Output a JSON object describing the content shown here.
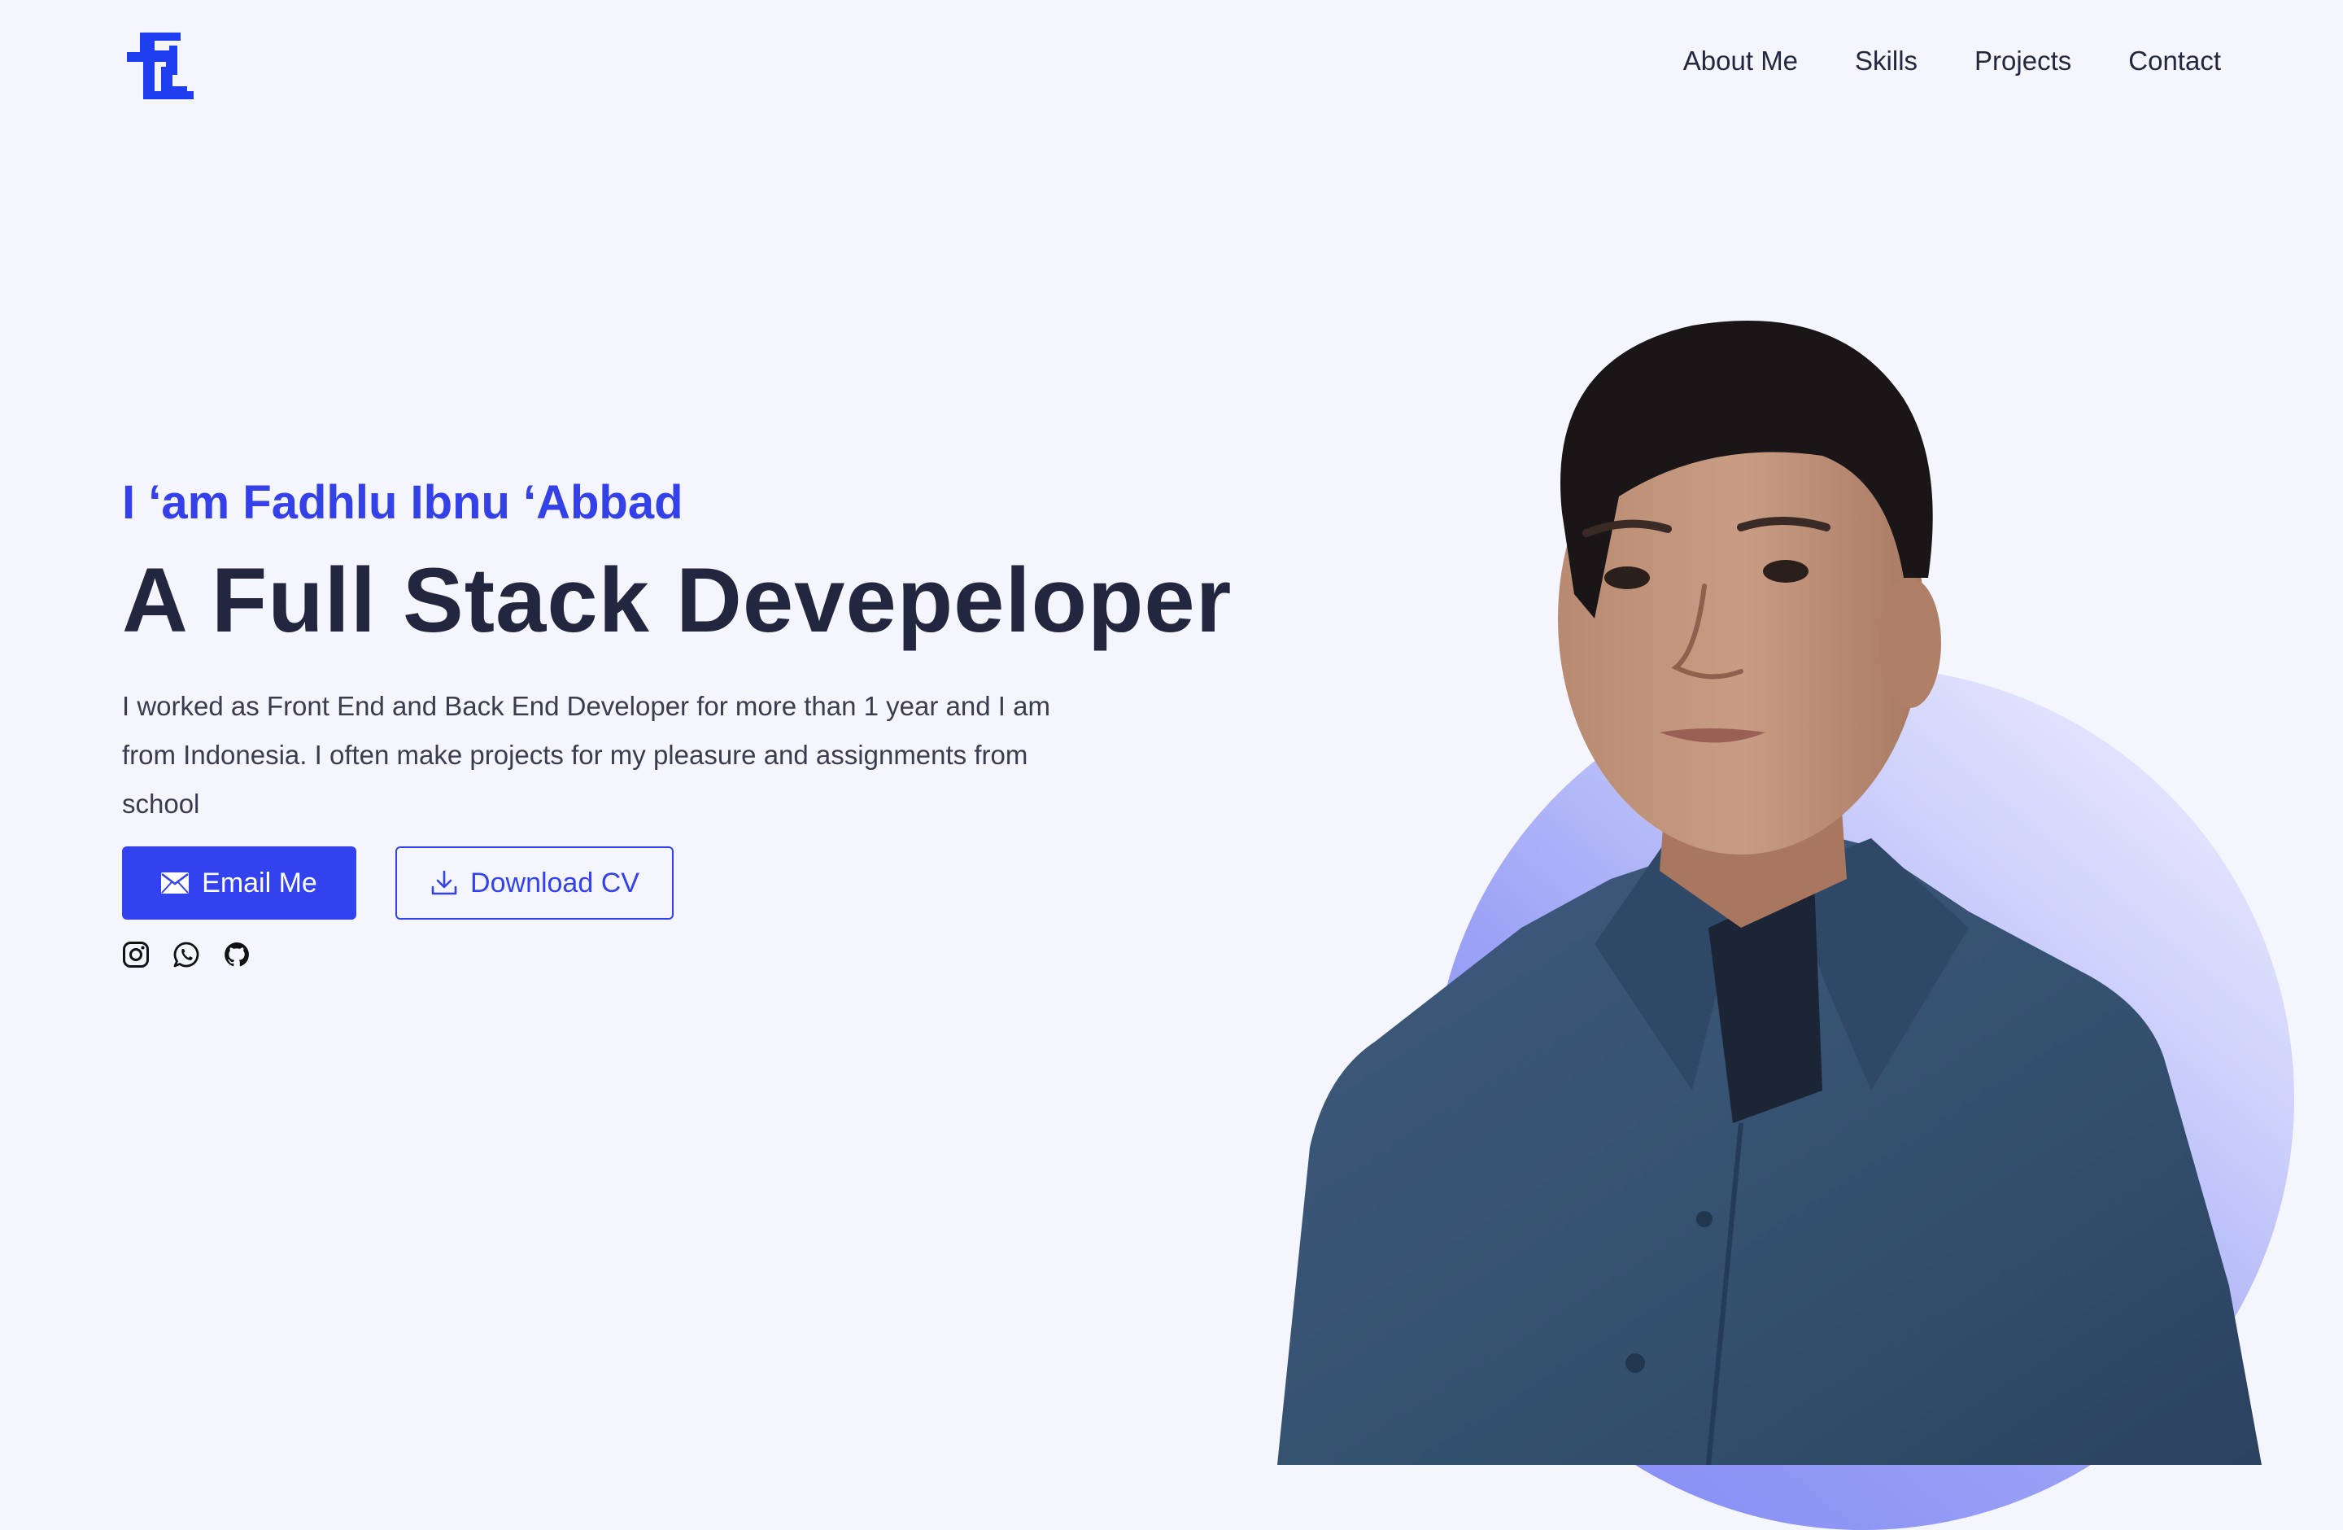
{
  "header": {
    "logo_name": "brand-logo",
    "nav": [
      {
        "label": "About Me"
      },
      {
        "label": "Skills"
      },
      {
        "label": "Projects"
      },
      {
        "label": "Contact"
      }
    ]
  },
  "hero": {
    "greeting": "I ‘am  Fadhlu Ibnu ‘Abbad",
    "headline": "A Full Stack Devepeloper",
    "description": "I worked as Front End and Back End Developer for more than 1 year and I am from Indonesia. I often make projects for my pleasure and assignments from school",
    "email_button": {
      "label": "Email Me",
      "icon": "envelope-icon"
    },
    "cv_button": {
      "label": "Download CV",
      "icon": "download-icon"
    },
    "socials": [
      {
        "icon": "instagram-icon"
      },
      {
        "icon": "whatsapp-icon"
      },
      {
        "icon": "github-icon"
      }
    ]
  },
  "colors": {
    "accent": "#3342ef",
    "background": "#f5f5fd",
    "heading": "#23263f",
    "shirt": "#36506f"
  }
}
